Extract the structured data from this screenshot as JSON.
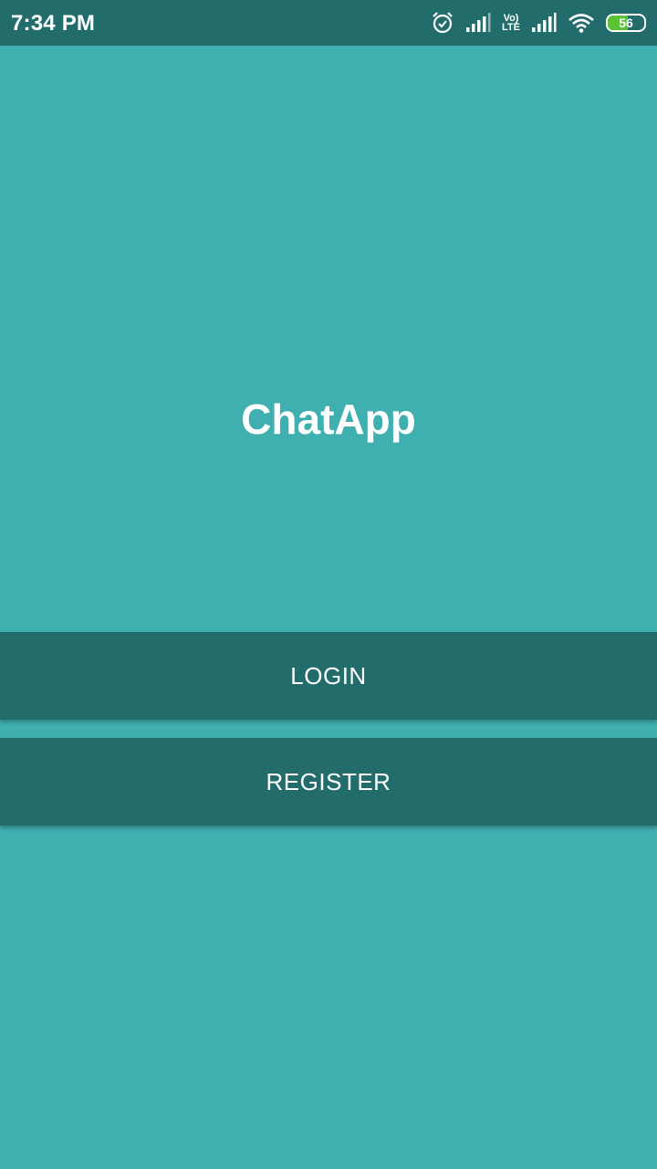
{
  "status_bar": {
    "time": "7:34 PM",
    "network_badge_top": "Vo)",
    "network_badge_bottom": "LTE",
    "battery_level": "56",
    "battery_fraction": 0.56,
    "icons": [
      "alarm-icon",
      "signal-icon",
      "volte-icon",
      "signal-icon",
      "wifi-icon",
      "battery-icon"
    ]
  },
  "app": {
    "title": "ChatApp"
  },
  "buttons": {
    "login": "LOGIN",
    "register": "REGISTER"
  },
  "colors": {
    "background": "#40AFAF",
    "status_bar": "#226C6C",
    "button": "#236C6C",
    "text": "#FFFFFF",
    "battery_fill": "#5BC236"
  }
}
